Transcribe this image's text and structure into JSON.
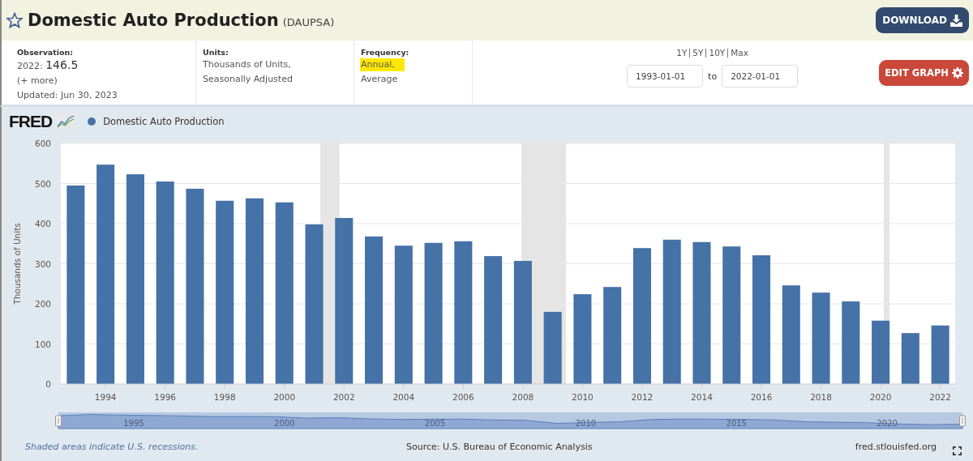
{
  "header": {
    "title": "Domestic Auto Production",
    "series_id": "(DAUPSA)",
    "download_button": "DOWNLOAD",
    "favorite": false
  },
  "info": {
    "observation": {
      "label": "Observation:",
      "date": "2022:",
      "value": "146.5",
      "more": "(+ more)",
      "updated": "Updated: Jun 30, 2023"
    },
    "units": {
      "label": "Units:",
      "lines": [
        "Thousands of Units,",
        "Seasonally Adjusted"
      ]
    },
    "frequency": {
      "label": "Frequency:",
      "lines": [
        {
          "text": "Annual,",
          "highlighted": true
        },
        {
          "text": "Average",
          "highlighted": false
        }
      ]
    },
    "ranges": [
      {
        "label": "1Y",
        "selected": false
      },
      {
        "label": "5Y",
        "selected": false
      },
      {
        "label": "10Y",
        "selected": false
      },
      {
        "label": "Max",
        "selected": false
      }
    ],
    "date_from": "1993-01-01",
    "date_to_label": "to",
    "date_to": "2022-01-01",
    "edit_button": "EDIT GRAPH"
  },
  "chart": {
    "logo": "FRED",
    "chart_data": {
      "type": "bar",
      "ylabel": "Thousands of Units",
      "x": [
        1993,
        1994,
        1995,
        1996,
        1997,
        1998,
        1999,
        2000,
        2001,
        2002,
        2003,
        2004,
        2005,
        2006,
        2007,
        2008,
        2009,
        2010,
        2011,
        2012,
        2013,
        2014,
        2015,
        2016,
        2017,
        2018,
        2019,
        2020,
        2021,
        2022
      ],
      "xlim": [
        1992.5,
        2022.5
      ],
      "grid": true,
      "series": [
        {
          "name": "Domestic Auto Production",
          "color": "#4572a7",
          "values": [
            495,
            547,
            523,
            505,
            487,
            457,
            463,
            453,
            398,
            414,
            368,
            345,
            352,
            356,
            319,
            307,
            180,
            224,
            242,
            339,
            360,
            354,
            343,
            321,
            246,
            228,
            206,
            158,
            127,
            146
          ]
        }
      ],
      "ylim": [
        0,
        600
      ],
      "yticks": [
        0,
        100,
        200,
        300,
        400,
        500,
        600
      ],
      "xticks": [
        1994,
        1996,
        1998,
        2000,
        2002,
        2004,
        2006,
        2008,
        2010,
        2012,
        2014,
        2016,
        2018,
        2020,
        2022
      ],
      "bands": [
        {
          "axis": "x",
          "from": 2001.2,
          "to": 2001.85
        },
        {
          "axis": "x",
          "from": 2007.95,
          "to": 2009.45
        },
        {
          "axis": "x",
          "from": 2020.1,
          "to": 2020.3
        }
      ]
    },
    "navigator_labels": [
      "1995",
      "2000",
      "2005",
      "2010",
      "2015",
      "2020"
    ]
  },
  "footer": {
    "note": "Shaded areas indicate U.S. recessions.",
    "source": "Source: U.S. Bureau of Economic Analysis",
    "site": "fred.stlouisfed.org"
  }
}
